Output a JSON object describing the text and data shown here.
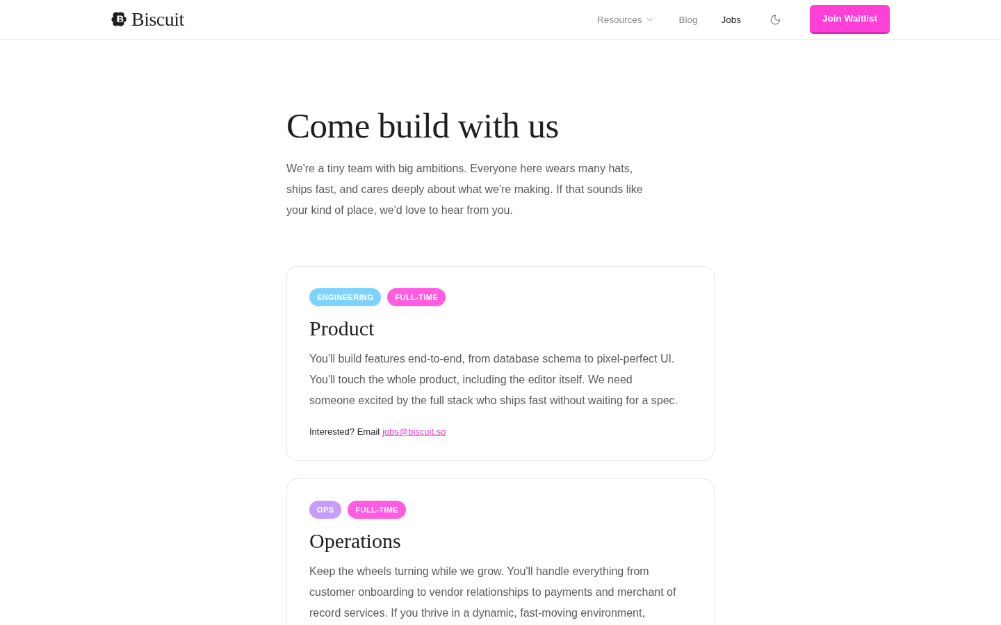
{
  "header": {
    "brand": "Biscuit",
    "nav": [
      {
        "label": "Resources",
        "kind": "dropdown",
        "selected": false
      },
      {
        "label": "Blog",
        "kind": "link",
        "selected": false
      },
      {
        "label": "Jobs",
        "kind": "link",
        "selected": true
      }
    ],
    "cta": "Join Waitlist"
  },
  "hero": {
    "title": "Come build with us",
    "intro": "We're a tiny team with big ambitions. Everyone here wears many hats, ships fast, and cares deeply about what we're making. If that sounds like your kind of place, we'd love to hear from you."
  },
  "jobs": [
    {
      "tags": [
        {
          "label": "ENGINEERING",
          "color": "#7dd3fc"
        },
        {
          "label": "FULL-TIME",
          "color": "#ff5ce1"
        }
      ],
      "title": "Product",
      "description": "You'll build features end-to-end, from database schema to pixel-perfect UI. You'll touch the whole product, including the editor itself. We need someone excited by the full stack who ships fast without waiting for a spec.",
      "contact": {
        "prompt": "Interested? Email",
        "email": "jobs@biscuit.so"
      }
    },
    {
      "tags": [
        {
          "label": "OPS",
          "color": "#c79cfb"
        },
        {
          "label": "FULL-TIME",
          "color": "#ff5ce1"
        }
      ],
      "title": "Operations",
      "description": "Keep the wheels turning while we grow. You'll handle everything from customer onboarding to vendor relationships to payments and merchant of record services. If you thrive in a dynamic, fast-moving environment,"
    }
  ]
}
